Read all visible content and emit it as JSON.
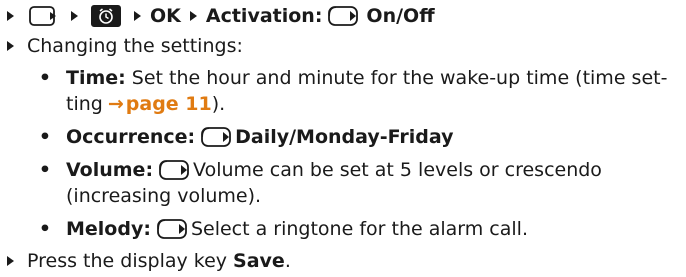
{
  "header_line": {
    "step_ok": "OK",
    "activation_label": "Activation:",
    "activation_value": "On/Off"
  },
  "changing_settings": "Changing the settings:",
  "items": [
    {
      "label": "Time:",
      "text_line1": "Set the hour and minute for the wake-up time (time set-",
      "text_line2_pre": "ting",
      "link_text": "page 11",
      "text_line2_post": ")."
    },
    {
      "label": "Occurrence:",
      "value": "Daily/Monday-Friday"
    },
    {
      "label": "Volume:",
      "text_line1": "Volume can be set at 5 levels or crescendo",
      "text_line2": "(increasing volume)."
    },
    {
      "label": "Melody:",
      "text_line1": "Select a ringtone for the alarm call."
    }
  ],
  "final_step": {
    "text": "Press the display key",
    "key_name": "Save",
    "period": "."
  },
  "icons": [
    "menu-key-icon",
    "alarm-clock-icon",
    "nav-key-icon",
    "arrow-right-icon",
    "bullet-triangle-icon"
  ],
  "colors": {
    "link": "#e07b12",
    "text": "#1a1a1a"
  }
}
